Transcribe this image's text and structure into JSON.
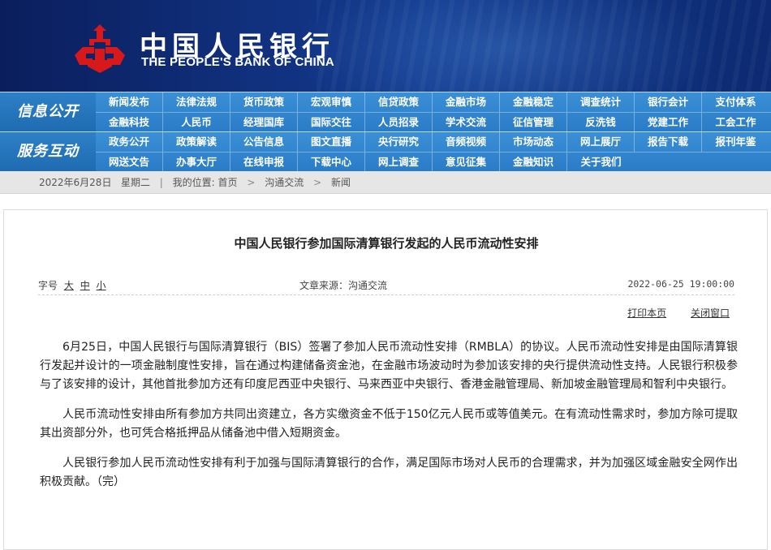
{
  "header": {
    "logo_cn": "中国人民银行",
    "logo_en": "THE PEOPLE'S BANK OF CHINA",
    "brand_red": "#d7191c"
  },
  "nav": {
    "info": {
      "label": "信息公开",
      "rows": [
        [
          "新闻发布",
          "法律法规",
          "货币政策",
          "宏观审慎",
          "信贷政策",
          "金融市场",
          "金融稳定",
          "调查统计",
          "银行会计",
          "支付体系"
        ],
        [
          "金融科技",
          "人民币",
          "经理国库",
          "国际交往",
          "人员招录",
          "学术交流",
          "征信管理",
          "反洗钱",
          "党建工作",
          "工会工作"
        ]
      ]
    },
    "service": {
      "label": "服务互动",
      "rows": [
        [
          "政务公开",
          "政策解读",
          "公告信息",
          "图文直播",
          "央行研究",
          "音频视频",
          "市场动态",
          "网上展厅",
          "报告下载",
          "报刊年鉴"
        ],
        [
          "网送文告",
          "办事大厅",
          "在线申报",
          "下载中心",
          "网上调查",
          "意见征集",
          "金融知识",
          "关于我们"
        ]
      ]
    }
  },
  "breadcrumb": {
    "date": "2022年6月28日",
    "weekday": "星期二",
    "location_label": "我的位置:",
    "home": "首页",
    "section": "沟通交流",
    "current": "新闻"
  },
  "article": {
    "title": "中国人民银行参加国际清算银行发起的人民币流动性安排",
    "fontsize_label": "字号",
    "fontsize_large": "大",
    "fontsize_medium": "中",
    "fontsize_small": "小",
    "source": "文章来源：沟通交流",
    "date": "2022-06-25 19:00:00",
    "print_label": "打印本页",
    "close_label": "关闭窗口",
    "paragraphs": [
      "6月25日，中国人民银行与国际清算银行（BIS）签署了参加人民币流动性安排（RMBLA）的协议。人民币流动性安排是由国际清算银行发起并设计的一项金融制度性安排，旨在通过构建储备资金池，在金融市场波动时为参加该安排的央行提供流动性支持。人民银行积极参与了该安排的设计，其他首批参加方还有印度尼西亚中央银行、马来西亚中央银行、香港金融管理局、新加坡金融管理局和智利中央银行。",
      "人民币流动性安排由所有参加方共同出资建立，各方实缴资金不低于150亿元人民币或等值美元。在有流动性需求时，参加方除可提取其出资部分外，也可凭合格抵押品从储备池中借入短期资金。",
      "人民银行参加人民币流动性安排有利于加强与国际清算银行的合作，满足国际市场对人民币的合理需求，并为加强区域金融安全网作出积极贡献。（完）"
    ]
  }
}
